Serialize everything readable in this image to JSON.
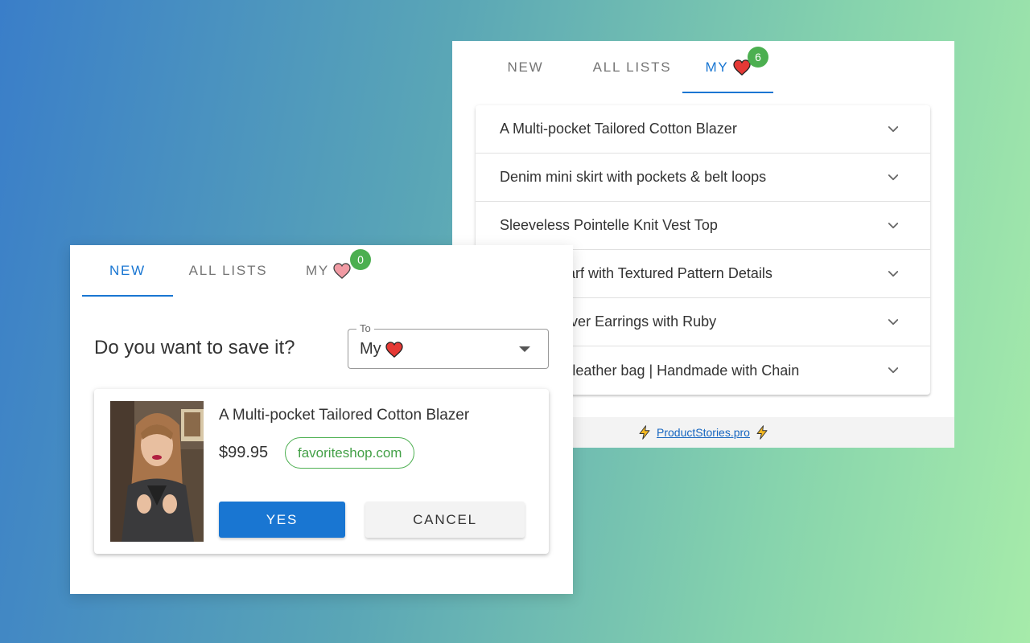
{
  "back_panel": {
    "tabs": [
      {
        "label": "NEW"
      },
      {
        "label": "ALL LISTS"
      },
      {
        "label": "MY",
        "badge": "6"
      }
    ],
    "active_tab": "MY",
    "items": [
      {
        "title": "A Multi-pocket Tailored Cotton Blazer"
      },
      {
        "title": "Denim mini skirt with pockets & belt loops"
      },
      {
        "title": "Sleeveless Pointelle Knit Vest Top"
      },
      {
        "title": "Square Scarf with Textured Pattern Details"
      },
      {
        "title": "Hooped Silver Earrings with Ruby"
      },
      {
        "title": "Yellow eco leather bag | Handmade with Chain"
      }
    ],
    "footer_link": "ProductStories.pro"
  },
  "front_panel": {
    "tabs": [
      {
        "label": "NEW"
      },
      {
        "label": "ALL LISTS"
      },
      {
        "label": "MY",
        "badge": "0"
      }
    ],
    "active_tab": "NEW",
    "question": "Do you want to save it?",
    "select": {
      "legend": "To",
      "value": "My"
    },
    "product": {
      "title": "A Multi-pocket Tailored Cotton Blazer",
      "price": "$99.95",
      "shop": "favoriteshop.com"
    },
    "yes_label": "YES",
    "cancel_label": "CANCEL"
  },
  "colors": {
    "accent": "#1976d2",
    "badge": "#4caf50",
    "heart_full": "#e53935",
    "heart_faded": "#ef8a95"
  },
  "icons": [
    "heart-icon",
    "chevron-down-icon",
    "lightning-icon",
    "dropdown-caret-icon"
  ]
}
